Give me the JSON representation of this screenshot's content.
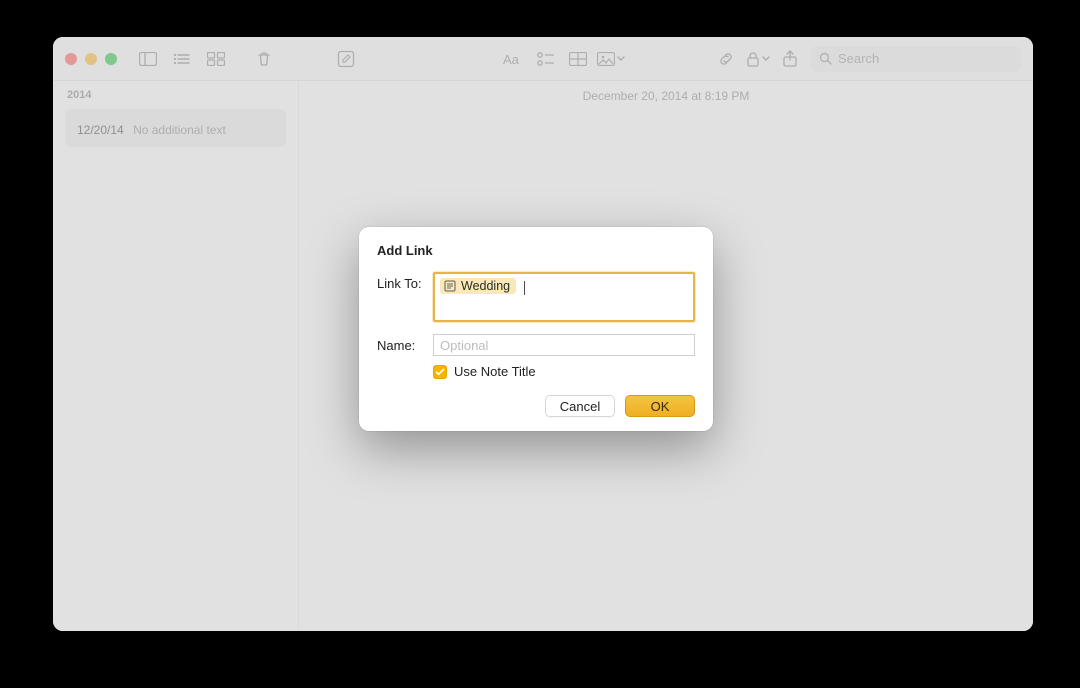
{
  "toolbar": {
    "search_placeholder": "Search"
  },
  "sidebar": {
    "section_label": "2014",
    "note": {
      "icon_char": "",
      "date": "12/20/14",
      "extra": "No additional text"
    }
  },
  "content": {
    "date_header": "December 20, 2014 at 8:19 PM",
    "body_icon_char": ""
  },
  "dialog": {
    "title": "Add Link",
    "linkto_label": "Link To:",
    "token_text": "Wedding",
    "name_label": "Name:",
    "name_placeholder": "Optional",
    "checkbox_label": "Use Note Title",
    "cancel_label": "Cancel",
    "ok_label": "OK"
  }
}
